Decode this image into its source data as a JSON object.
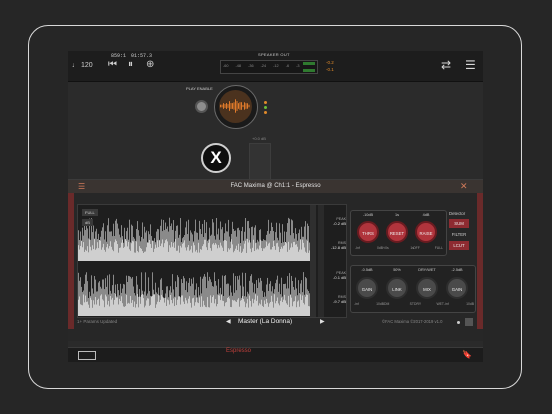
{
  "topbar": {
    "tempo": "♩ 120",
    "timecode_left": "859:1",
    "timecode_right": "01:57.3",
    "meter_label": "SPEAKER OUT",
    "meter_ticks": "-60 -48 -36 -24 -12 -6 -3",
    "peak_top": "-0.2",
    "peak_bottom": "-0.1",
    "meter_level_fraction": 0.95
  },
  "canvas": {
    "play_enable_label": "PLAY ENABLE",
    "fader_label": "+0.0 dB"
  },
  "plugin": {
    "title": "FAC Maxima @ Ch1:1 - Espresso",
    "wave_full_label": "FULL",
    "wave_small_label": "dB",
    "stats_top": [
      {
        "label": "PEAK",
        "value": "-0.2 dB"
      },
      {
        "label": "RMS",
        "value": "-12.8 dB"
      }
    ],
    "stats_bottom": [
      {
        "label": "PEAK",
        "value": "-0.1 dB"
      },
      {
        "label": "RMS",
        "value": "-9.7 dB"
      }
    ],
    "knobs": {
      "thres": {
        "top": "-10dB",
        "label": "THRS",
        "min": "-Inf",
        "max": "0dB+"
      },
      "reset": {
        "top": "1s",
        "label": "RESET",
        "min": "-0s",
        "max": "1s"
      },
      "raise": {
        "top": "4dB",
        "label": "RAISE",
        "min": "OFF",
        "max": "FULL"
      },
      "gain1": {
        "top": "-0.5dB",
        "label": "GAIN",
        "min": "-inf",
        "max": "10dB"
      },
      "link": {
        "top": "50%",
        "label": "LINK",
        "min": "DM",
        "max": "ST"
      },
      "mix": {
        "top": "DRY/WET",
        "label": "MIX",
        "min": "DRY",
        "max": "WET"
      },
      "gain2": {
        "top": "-2.5dB",
        "label": "GAIN",
        "min": "-inf",
        "max": "10dB"
      }
    },
    "detector": {
      "label": "Detector",
      "sum": "SUM",
      "filter": "FILTER",
      "lcut": "LCUT"
    },
    "status": "1+ Params Updated",
    "preset": "Master (La Donna)",
    "version": "©FAC Maxima ©2017-2019 v1.0",
    "prev_arrow": "◀",
    "next_arrow": "▶",
    "close_glyph": "✕",
    "menu_glyph": "☰"
  },
  "bottom": {
    "channel_name": "Espresso"
  },
  "colors": {
    "accent": "#e07a2a",
    "plugin_red": "#b0343c",
    "channel_red": "#c0403c"
  }
}
